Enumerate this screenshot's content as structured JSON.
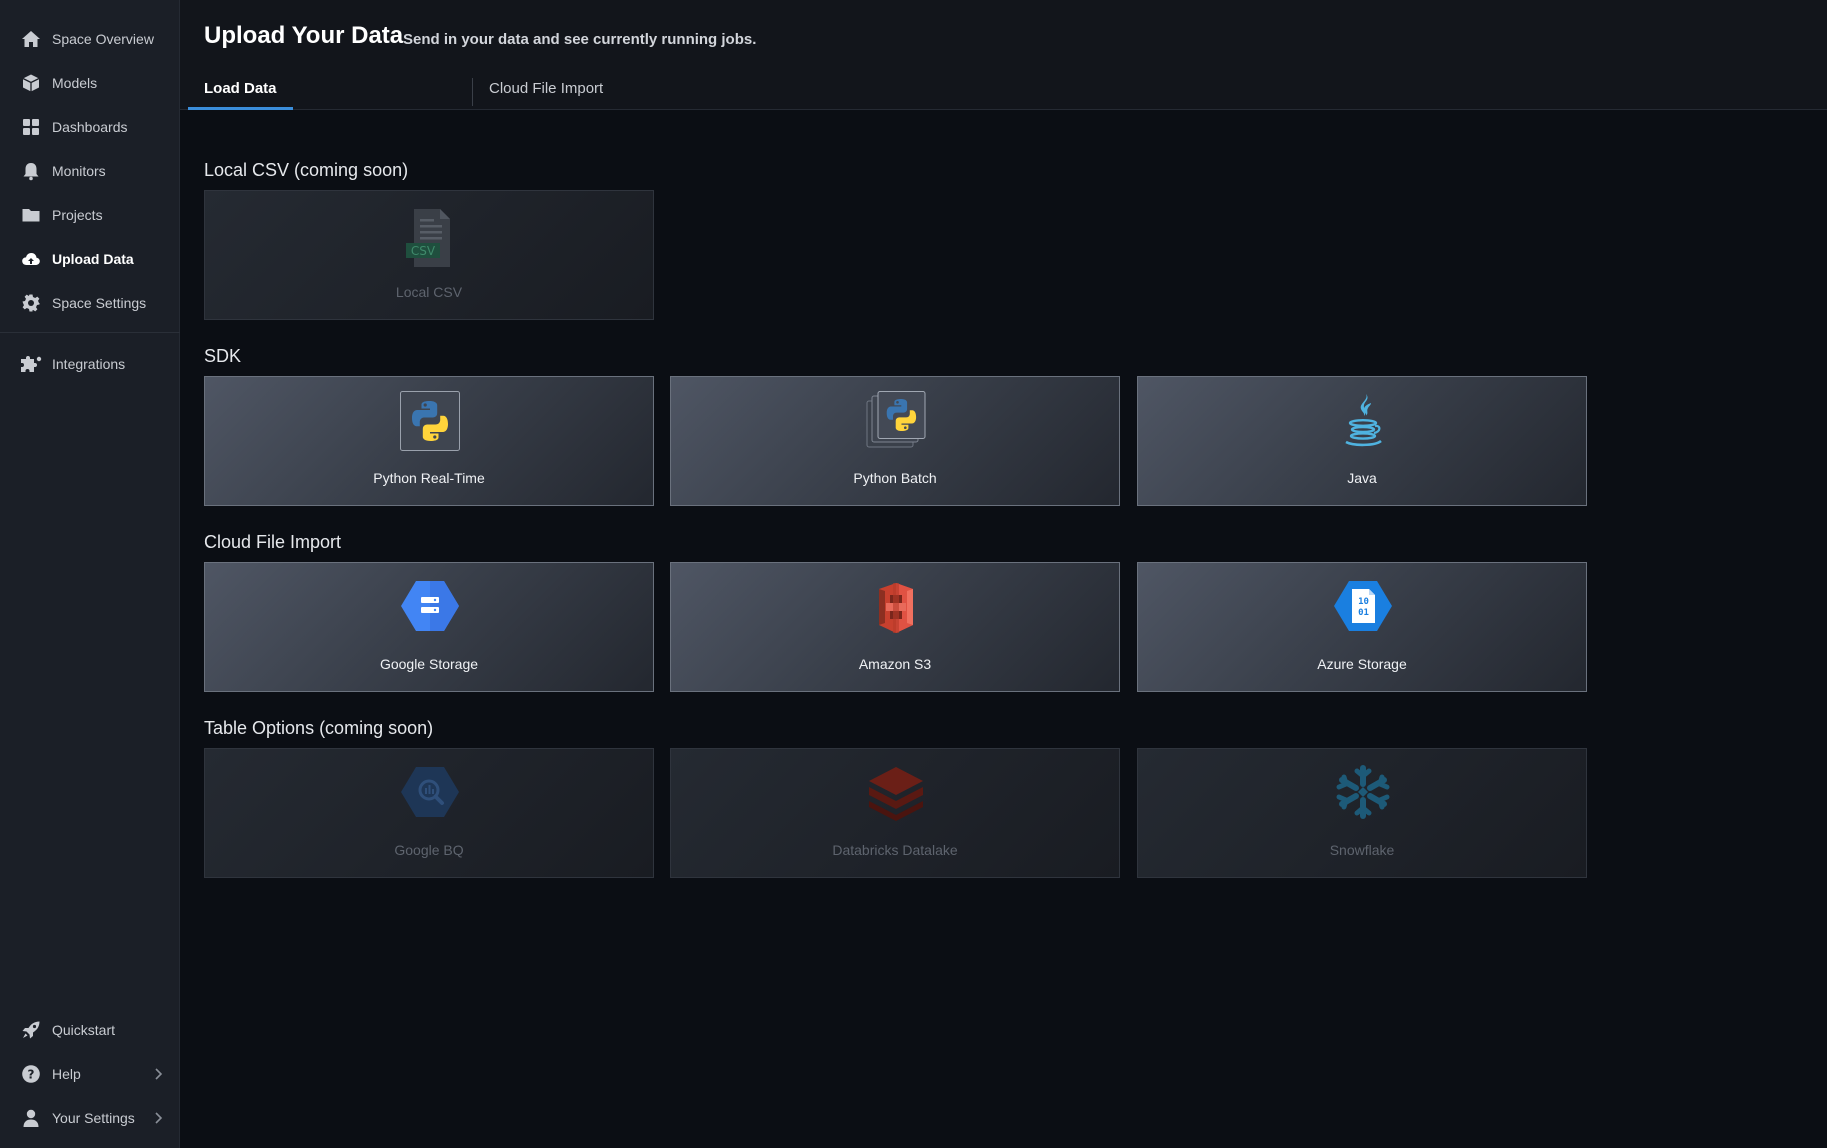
{
  "sidebar": {
    "items": [
      {
        "label": "Space Overview",
        "icon": "home-icon"
      },
      {
        "label": "Models",
        "icon": "cube-icon"
      },
      {
        "label": "Dashboards",
        "icon": "grid-icon"
      },
      {
        "label": "Monitors",
        "icon": "bell-icon"
      },
      {
        "label": "Projects",
        "icon": "folder-icon"
      },
      {
        "label": "Upload Data",
        "icon": "cloud-upload-icon",
        "active": true
      },
      {
        "label": "Space Settings",
        "icon": "gear-icon"
      },
      {
        "label": "Integrations",
        "icon": "puzzle-icon"
      }
    ],
    "bottom": [
      {
        "label": "Quickstart",
        "icon": "rocket-icon"
      },
      {
        "label": "Help",
        "icon": "question-icon"
      },
      {
        "label": "Your Settings",
        "icon": "user-icon"
      }
    ]
  },
  "header": {
    "title": "Upload Your Data",
    "subtitle": "Send in your data and see currently running jobs.",
    "tabs": [
      {
        "label": "Load Data",
        "active": true
      },
      {
        "label": "Cloud File Import",
        "active": false
      }
    ]
  },
  "sections": [
    {
      "title": "Local CSV (coming soon)",
      "cards": [
        {
          "label": "Local CSV",
          "icon": "csv-file-icon",
          "disabled": true,
          "badge": "CSV"
        }
      ]
    },
    {
      "title": "SDK",
      "cards": [
        {
          "label": "Python Real-Time",
          "icon": "python-icon",
          "disabled": false
        },
        {
          "label": "Python Batch",
          "icon": "python-batch-icon",
          "disabled": false
        },
        {
          "label": "Java",
          "icon": "java-icon",
          "disabled": false
        }
      ]
    },
    {
      "title": "Cloud File Import",
      "cards": [
        {
          "label": "Google Storage",
          "icon": "google-storage-icon",
          "disabled": false
        },
        {
          "label": "Amazon S3",
          "icon": "amazon-s3-icon",
          "disabled": false
        },
        {
          "label": "Azure Storage",
          "icon": "azure-storage-icon",
          "disabled": false,
          "badge": "10 01"
        }
      ]
    },
    {
      "title": "Table Options (coming soon)",
      "cards": [
        {
          "label": "Google BQ",
          "icon": "google-bigquery-icon",
          "disabled": true
        },
        {
          "label": "Databricks Datalake",
          "icon": "databricks-icon",
          "disabled": true
        },
        {
          "label": "Snowflake",
          "icon": "snowflake-icon",
          "disabled": true
        }
      ]
    }
  ],
  "colors": {
    "accent": "#3b8edb",
    "sidebar_bg": "#1b1f27",
    "content_bg": "#0b0e14"
  }
}
